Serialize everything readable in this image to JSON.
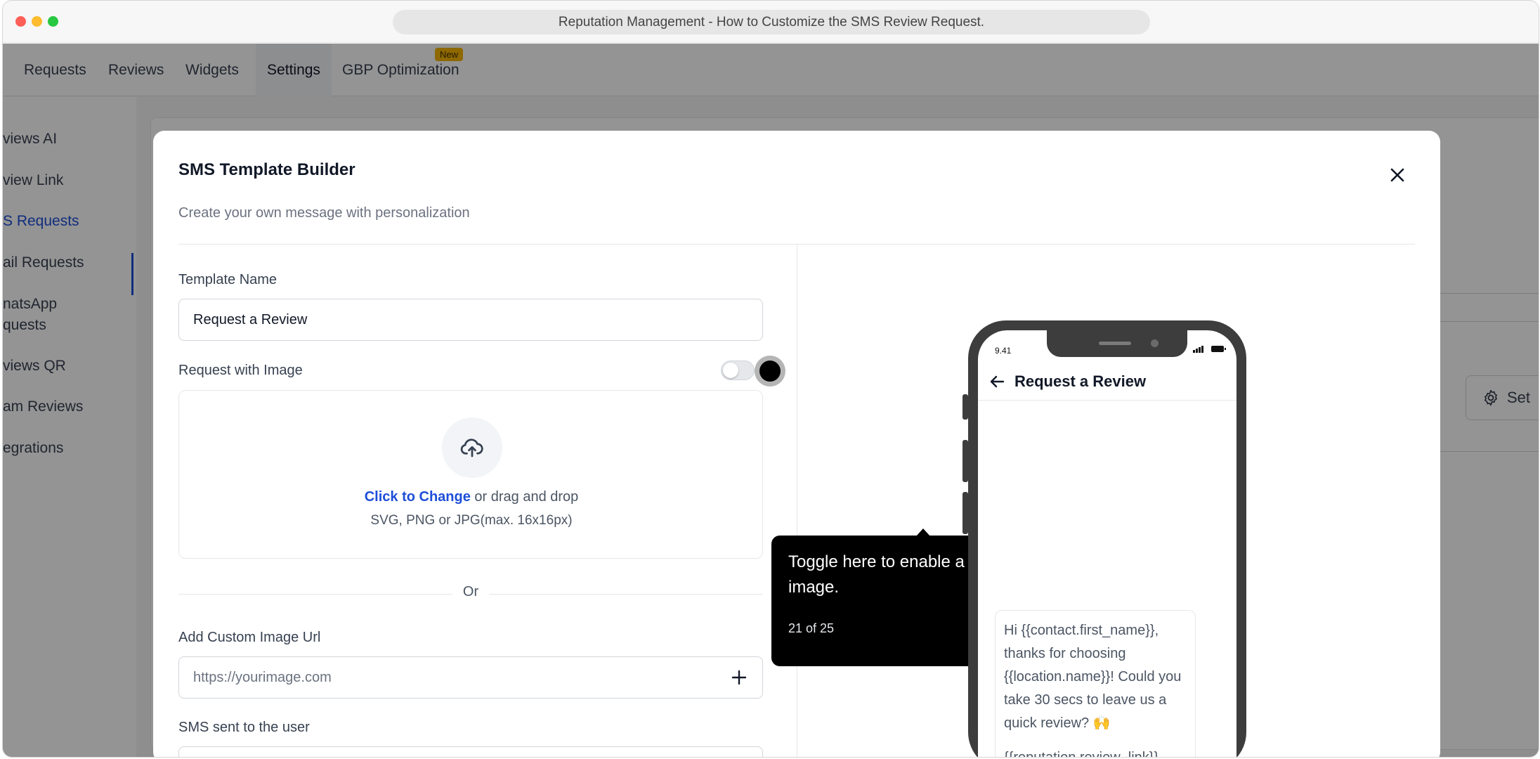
{
  "window": {
    "title": "Reputation Management - How to Customize the SMS Review Request."
  },
  "topnav": {
    "tabs": [
      "Requests",
      "Reviews",
      "Widgets",
      "Settings",
      "GBP Optimization"
    ],
    "active_tab": "Settings",
    "new_badge": "New"
  },
  "sidebar": {
    "items": [
      "views AI",
      "view Link",
      "S Requests",
      "ail Requests",
      "natsApp",
      "quests",
      "views QR",
      "am Reviews",
      "egrations"
    ],
    "active_index": 2
  },
  "background": {
    "settings_button": "Set"
  },
  "modal": {
    "title": "SMS Template Builder",
    "subtitle": "Create your own message with personalization",
    "template_name_label": "Template Name",
    "template_name_value": "Request a Review",
    "request_with_image_label": "Request with Image",
    "toggle_on": false,
    "upload_link": "Click to Change",
    "upload_text": " or drag and drop",
    "upload_hint": "SVG, PNG or JPG(max. 16x16px)",
    "or_text": "Or",
    "custom_image_label": "Add Custom Image Url",
    "custom_image_placeholder": "https://yourimage.com",
    "sms_label": "SMS sent to the user"
  },
  "tooltip": {
    "text": "Toggle here to enable a request with image.",
    "step": "21 of 25"
  },
  "phone": {
    "time": "9.41",
    "header_title": "Request a Review",
    "message": "Hi {{contact.first_name}}, thanks for choosing {{location.name}}! Could you take 30 secs to leave us a quick review? 🙌",
    "review_link": "{{reputation.review_link}}"
  },
  "colors": {
    "accent": "#1d4ed8",
    "badge": "#f5b400",
    "tooltip_bg": "#000000"
  }
}
